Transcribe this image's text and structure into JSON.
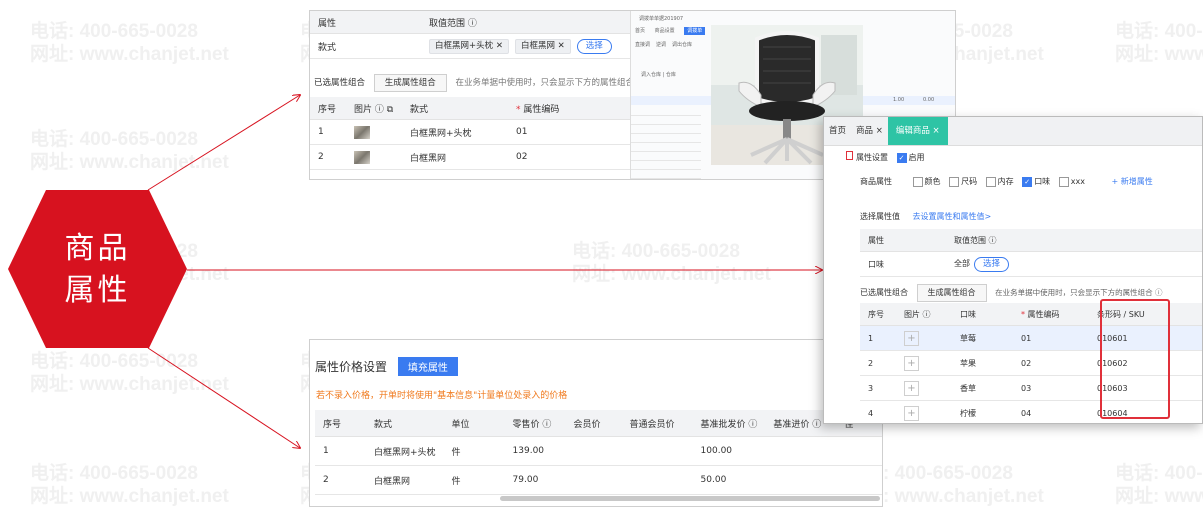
{
  "watermark": {
    "phone": "电话: 400-665-0028",
    "site": "网址: www.chanjet.net"
  },
  "badge": {
    "line1": "商品",
    "line2": "属性"
  },
  "top_panel": {
    "header_attr": "属性",
    "header_range": "取值范围 ⓘ",
    "row_label": "款式",
    "tags": [
      "白框黑网+头枕 ✕",
      "白框黑网 ✕"
    ],
    "select_label": "选择",
    "combo_label": "已选属性组合",
    "gen_button": "生成属性组合",
    "note": "在业务单据中使用时，只会显示下方的属性组合 ⓘ",
    "columns": [
      "序号",
      "图片 ⓘ",
      "款式",
      "属性编码"
    ],
    "rows": [
      {
        "no": "1",
        "style": "白框黑网+头枕",
        "code": "01"
      },
      {
        "no": "2",
        "style": "白框黑网",
        "code": "02"
      }
    ],
    "mini_title": "调拨单单据201907",
    "mini_tabs": [
      "首页",
      "商品设置",
      "调拨单"
    ],
    "mini_options": [
      "直接调",
      "逆调",
      "调出仓库"
    ],
    "mini_field": "调入仓库 | 仓库",
    "mini_values": [
      "1.00",
      "0.00"
    ]
  },
  "price_panel": {
    "title": "属性价格设置",
    "fill_button": "填充属性",
    "warning": "若不录入价格，开单时将使用\"基本信息\"计量单位处录入的价格",
    "columns": [
      "序号",
      "款式",
      "单位",
      "零售价 ⓘ",
      "会员价",
      "普通会员价",
      "基准批发价 ⓘ",
      "基准进价 ⓘ",
      "佳"
    ],
    "rows": [
      {
        "no": "1",
        "style": "白框黑网+头枕",
        "unit": "件",
        "retail": "139.00",
        "wholesale": "100.00"
      },
      {
        "no": "2",
        "style": "白框黑网",
        "unit": "件",
        "retail": "79.00",
        "wholesale": "50.00"
      }
    ]
  },
  "edit_panel": {
    "tabs": [
      "首页",
      "商品 ×",
      "编辑商品 ×"
    ],
    "attr_setting": "属性设置",
    "enable": "启用",
    "goods_attr": "商品属性",
    "options": [
      "颜色",
      "尺码",
      "内存",
      "口味",
      "xxx"
    ],
    "add_attr": "+ 新增属性",
    "select_value_label": "选择属性值",
    "go_setting": "去设置属性和属性值>",
    "header_attr": "属性",
    "header_range": "取值范围 ⓘ",
    "row_label": "口味",
    "all_label": "全部",
    "select_label": "选择",
    "combo_label": "已选属性组合",
    "gen_button": "生成属性组合",
    "note": "在业务单据中使用时，只会显示下方的属性组合 ⓘ",
    "columns": [
      "序号",
      "图片 ⓘ",
      "口味",
      "属性编码",
      "条形码 / SKU"
    ],
    "rows": [
      {
        "no": "1",
        "flavor": "草莓",
        "code": "01",
        "sku": "010601"
      },
      {
        "no": "2",
        "flavor": "苹果",
        "code": "02",
        "sku": "010602"
      },
      {
        "no": "3",
        "flavor": "香草",
        "code": "03",
        "sku": "010603"
      },
      {
        "no": "4",
        "flavor": "柠檬",
        "code": "04",
        "sku": "010604"
      }
    ]
  },
  "colors": {
    "accent": "#3a7bf0",
    "badge": "#d7121f",
    "arrow": "#d7121f",
    "teal": "#2ec4a5",
    "sku_border": "#e0303a",
    "warning": "#f07a1e"
  }
}
